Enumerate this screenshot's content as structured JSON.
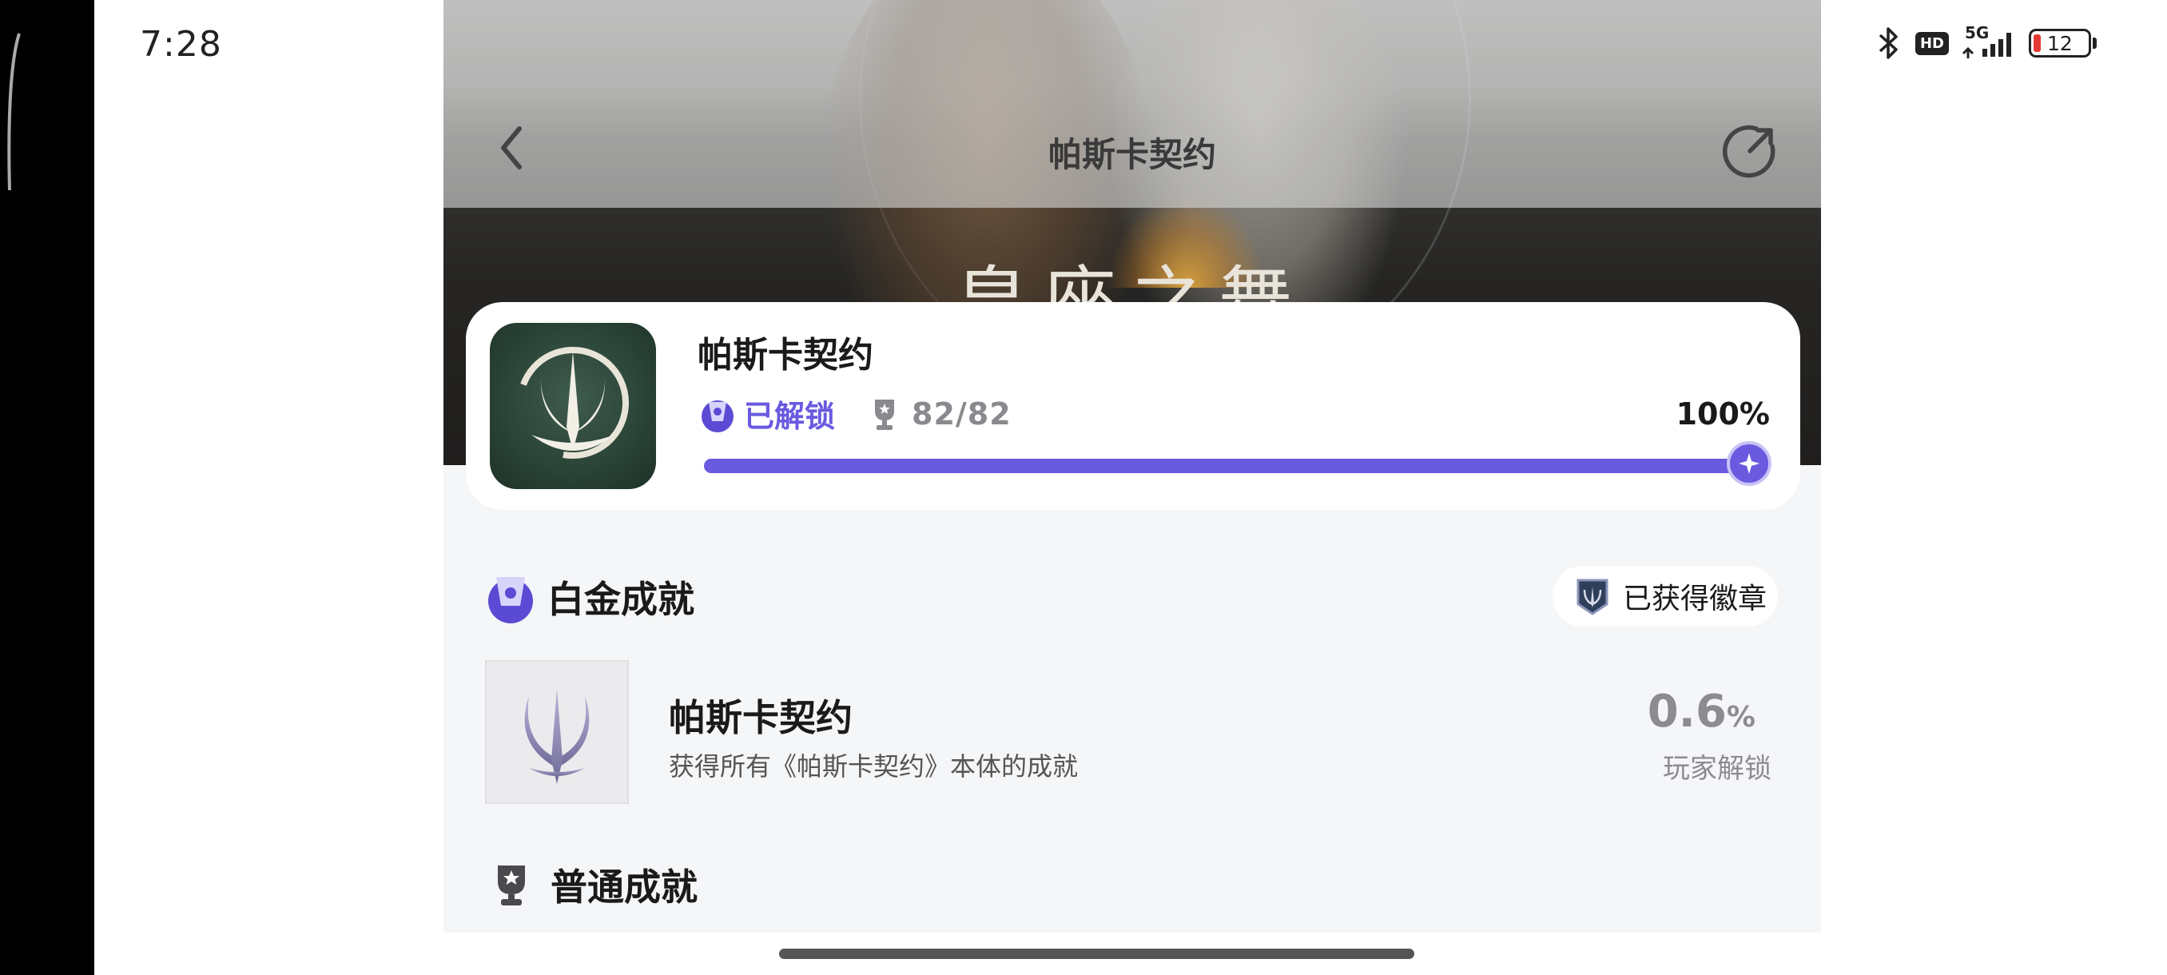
{
  "status_bar": {
    "time": "7:28",
    "network": "5G",
    "hd": "HD",
    "battery": "12",
    "battery_color": "#e53935"
  },
  "header": {
    "title": "帕斯卡契约",
    "back_icon": "chevron-left-icon",
    "share_icon": "share-icon"
  },
  "banner": {
    "text": "皇座之舞"
  },
  "game": {
    "name": "帕斯卡契约",
    "unlock_label": "已解锁",
    "trophy_count": "82/82",
    "percent": "100%",
    "progress": 1.0,
    "accent": "#6a5ae0"
  },
  "platinum": {
    "section_label": "白金成就",
    "badge_label": "已获得徽章",
    "achievement": {
      "title": "帕斯卡契约",
      "description": "获得所有《帕斯卡契约》本体的成就",
      "rate_value": "0.6",
      "rate_unit": "%",
      "rate_label": "玩家解锁"
    }
  },
  "normal": {
    "section_label": "普通成就"
  }
}
